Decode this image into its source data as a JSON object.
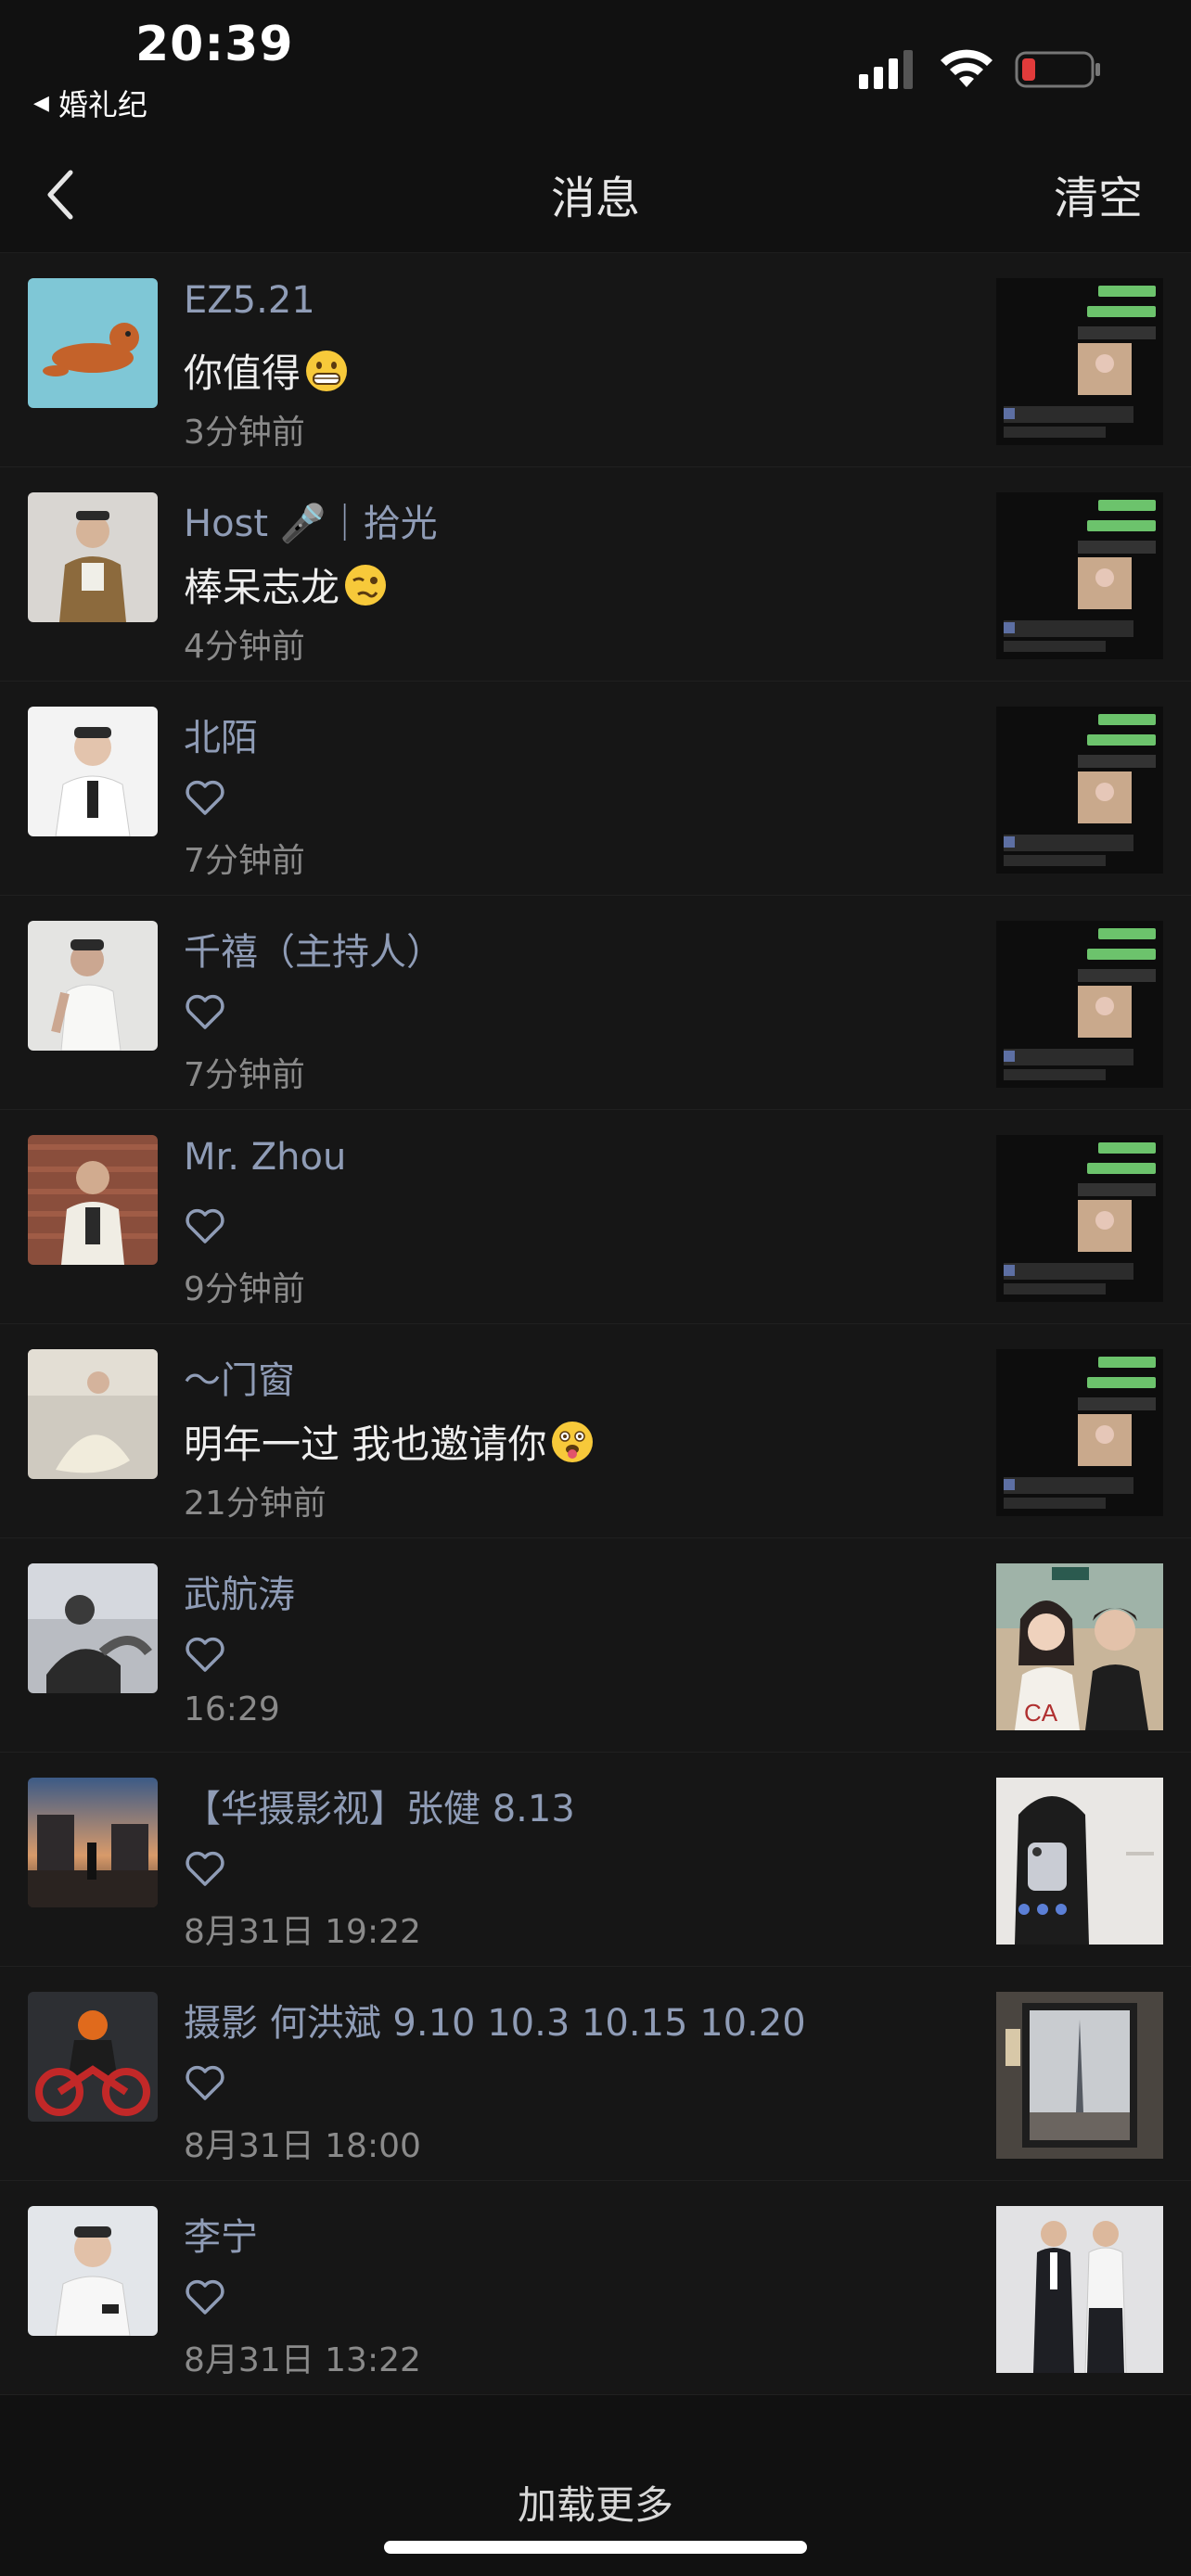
{
  "status_bar": {
    "time": "20:39",
    "back_app_label": "婚礼纪"
  },
  "nav": {
    "title": "消息",
    "clear_label": "清空"
  },
  "messages": [
    {
      "name": "EZ5.21",
      "text": "你值得",
      "emoji": "grinning-face-emoji",
      "liked": false,
      "time": "3分钟前",
      "thumb": "chat-screenshot-thumbnail"
    },
    {
      "name": "Host 🎤｜拾光",
      "text": "棒呆志龙",
      "emoji": "woozy-face-emoji",
      "liked": false,
      "time": "4分钟前",
      "thumb": "chat-screenshot-thumbnail"
    },
    {
      "name": "北陌",
      "text": "",
      "emoji": "",
      "liked": true,
      "time": "7分钟前",
      "thumb": "chat-screenshot-thumbnail"
    },
    {
      "name": "千禧（主持人）",
      "text": "",
      "emoji": "",
      "liked": true,
      "time": "7分钟前",
      "thumb": "chat-screenshot-thumbnail"
    },
    {
      "name": "Mr. Zhou",
      "text": "",
      "emoji": "",
      "liked": true,
      "time": "9分钟前",
      "thumb": "chat-screenshot-thumbnail"
    },
    {
      "name": "～门窗",
      "text": "明年一过 我也邀请你",
      "emoji": "face-with-tongue-emoji",
      "liked": false,
      "time": "21分钟前",
      "thumb": "chat-screenshot-thumbnail"
    },
    {
      "name": "武航涛",
      "text": "",
      "emoji": "",
      "liked": true,
      "time": "16:29",
      "thumb": "couple-photo-thumbnail"
    },
    {
      "name": "【华摄影视】张健 8.13",
      "text": "",
      "emoji": "",
      "liked": true,
      "time": "8月31日 19:22",
      "thumb": "mirror-selfie-thumbnail"
    },
    {
      "name": "摄影 何洪斌 9.10 10.3 10.15 10.20",
      "text": "",
      "emoji": "",
      "liked": true,
      "time": "8月31日 18:00",
      "thumb": "framed-tower-photo-thumbnail"
    },
    {
      "name": "李宁",
      "text": "",
      "emoji": "",
      "liked": true,
      "time": "8月31日 13:22",
      "thumb": "two-men-suits-thumbnail"
    }
  ],
  "footer": {
    "load_more_label": "加载更多"
  },
  "colors": {
    "background": "#111111",
    "row_background": "#161616",
    "name_text": "#8f9cb6",
    "time_text": "#8a8a8a",
    "battery_low": "#e23b3b"
  }
}
